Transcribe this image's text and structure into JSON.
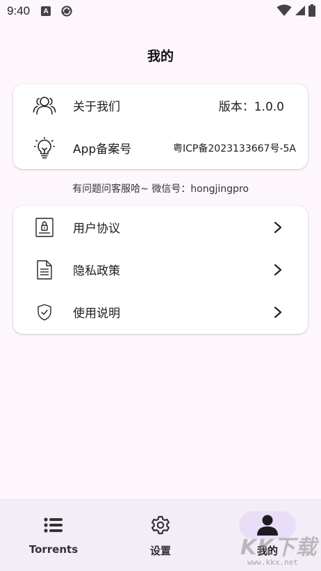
{
  "status_bar": {
    "time": "9:40",
    "badge": "A"
  },
  "page": {
    "title": "我的"
  },
  "about_card": {
    "items": [
      {
        "icon": "users-icon",
        "label": "关于我们",
        "value": "版本：1.0.0"
      },
      {
        "icon": "lightbulb-icon",
        "label": "App备案号",
        "value": "粤ICP备2023133667号-5A"
      }
    ]
  },
  "contact": {
    "text": "有问题问客服哈~ 微信号：hongjingpro"
  },
  "links_card": {
    "items": [
      {
        "icon": "agreement-icon",
        "label": "用户协议"
      },
      {
        "icon": "document-icon",
        "label": "隐私政策"
      },
      {
        "icon": "shield-check-icon",
        "label": "使用说明"
      }
    ]
  },
  "bottom_nav": {
    "items": [
      {
        "icon": "list-icon",
        "label": "Torrents",
        "active": false
      },
      {
        "icon": "gear-icon",
        "label": "设置",
        "active": false
      },
      {
        "icon": "person-icon",
        "label": "我的",
        "active": true
      }
    ]
  },
  "watermark": {
    "logo": "KK下载",
    "url": "www.kkx.net"
  },
  "colors": {
    "background": "#fdf6fc",
    "card": "#ffffff",
    "nav_background": "#f3edf7",
    "nav_active_pill": "#e8def8"
  }
}
